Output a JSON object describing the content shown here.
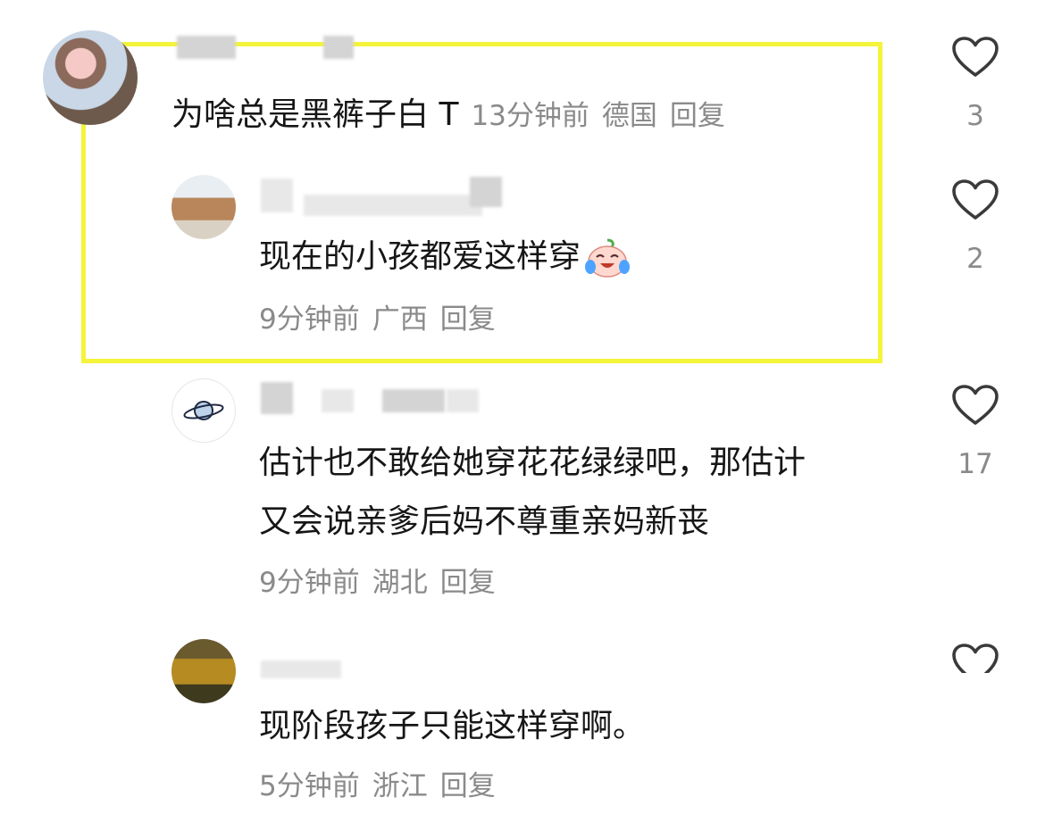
{
  "colors": {
    "highlight": "#f4f43b",
    "meta_text": "#8a8a8a",
    "body_text": "#161616"
  },
  "comments": [
    {
      "text": "为啥总是黑裤子白 T",
      "time": "13分钟前",
      "location": "德国",
      "reply": "回复",
      "likes": "3"
    },
    {
      "text": "现在的小孩都爱这样穿",
      "emoji": "crying-laughing-peach-emoji",
      "time": "9分钟前",
      "location": "广西",
      "reply": "回复",
      "likes": "2"
    },
    {
      "text_line1": "估计也不敢给她穿花花绿绿吧，那估计",
      "text_line2": "又会说亲爹后妈不尊重亲妈新丧",
      "avatar_icon": "planet-icon",
      "time": "9分钟前",
      "location": "湖北",
      "reply": "回复",
      "likes": "17"
    },
    {
      "text": "现阶段孩子只能这样穿啊。",
      "time": "5分钟前",
      "location": "浙江",
      "reply": "回复"
    }
  ]
}
